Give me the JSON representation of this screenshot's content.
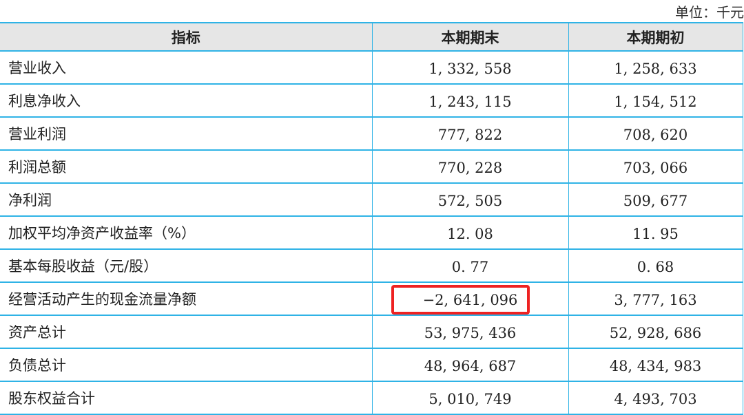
{
  "unit_label": "单位：千元",
  "table": {
    "headers": [
      "指标",
      "本期期末",
      "本期期初"
    ],
    "rows": [
      {
        "label": "营业收入",
        "end": "1, 332, 558",
        "begin": "1, 258, 633"
      },
      {
        "label": "利息净收入",
        "end": "1, 243, 115",
        "begin": "1, 154, 512"
      },
      {
        "label": "营业利润",
        "end": "777, 822",
        "begin": "708, 620"
      },
      {
        "label": "利润总额",
        "end": "770, 228",
        "begin": "703, 066"
      },
      {
        "label": "净利润",
        "end": "572, 505",
        "begin": "509, 677"
      },
      {
        "label": "加权平均净资产收益率（%）",
        "end": "12. 08",
        "begin": "11. 95"
      },
      {
        "label": "基本每股收益（元/股）",
        "end": "0. 77",
        "begin": "0. 68"
      },
      {
        "label": "经营活动产生的现金流量净额",
        "end": "−2, 641, 096",
        "begin": "3, 777, 163",
        "highlighted": true
      },
      {
        "label": "资产总计",
        "end": "53, 975, 436",
        "begin": "52, 928, 686"
      },
      {
        "label": "负债总计",
        "end": "48, 964, 687",
        "begin": "48, 434, 983"
      },
      {
        "label": "股东权益合计",
        "end": "5, 010, 749",
        "begin": "4, 493, 703"
      }
    ]
  },
  "colors": {
    "border": "#2fb3e6",
    "header_bg": "#e6e6e6",
    "highlight": "#ee2222"
  }
}
